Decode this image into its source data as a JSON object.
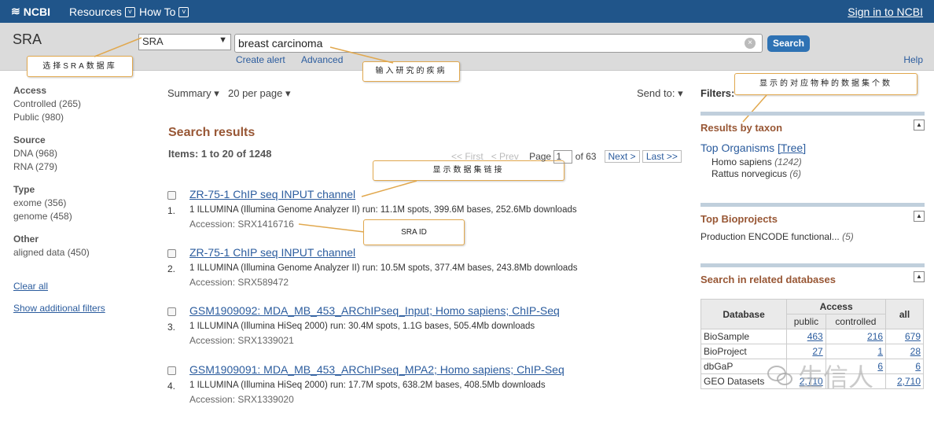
{
  "topbar": {
    "logo_mark": "≋",
    "logo_text": "NCBI",
    "resources": "Resources",
    "howto": "How To",
    "chev": "˅",
    "signin": "Sign in to NCBI"
  },
  "search": {
    "db_title": "SRA",
    "db_select": "SRA",
    "select_arrow": "▼",
    "query": "breast carcinoma",
    "clear": "×",
    "button": "Search",
    "create_alert": "Create alert",
    "advanced": "Advanced",
    "help": "Help"
  },
  "callouts": {
    "select_db": "选择SRA数据库",
    "enter_term": "输入研究的疾病",
    "organism_count": "显示的对应物种的数据集个数",
    "dataset_link": "显示数据集链接",
    "sra_id": "SRA ID"
  },
  "sidebar": {
    "groups": [
      {
        "head": "Access",
        "items": [
          "Controlled (265)",
          "Public (980)"
        ]
      },
      {
        "head": "Source",
        "items": [
          "DNA (968)",
          "RNA (279)"
        ]
      },
      {
        "head": "Type",
        "items": [
          "exome (356)",
          "genome (458)"
        ]
      },
      {
        "head": "Other",
        "items": [
          "aligned data (450)"
        ]
      }
    ],
    "clear_all": "Clear all",
    "show_filters": "Show additional filters"
  },
  "main": {
    "summary": "Summary",
    "per_page": "20 per page",
    "send_to": "Send to:",
    "dropdown_arrow": "▾",
    "results_title": "Search results",
    "items": "Items: 1 to 20 of 1248",
    "pager": {
      "first": "<< First",
      "prev": "< Prev",
      "page_label": "Page",
      "page_value": "1",
      "of": "of 63",
      "next": "Next >",
      "last": "Last >>"
    },
    "results": [
      {
        "num": "1.",
        "title": "ZR-75-1 ChIP seq INPUT channel",
        "desc": "1 ILLUMINA (Illumina Genome Analyzer II) run: 11.1M spots, 399.6M bases, 252.6Mb downloads",
        "acc": "Accession: SRX1416716"
      },
      {
        "num": "2.",
        "title": "ZR-75-1 ChIP seq INPUT channel",
        "desc": "1 ILLUMINA (Illumina Genome Analyzer II) run: 10.5M spots, 377.4M bases, 243.8Mb downloads",
        "acc": "Accession: SRX589472"
      },
      {
        "num": "3.",
        "title": "GSM1909092: MDA_MB_453_ARChIPseq_Input; Homo sapiens; ChIP-Seq",
        "desc": "1 ILLUMINA (Illumina HiSeq 2000) run: 30.4M spots, 1.1G bases, 505.4Mb downloads",
        "acc": "Accession: SRX1339021"
      },
      {
        "num": "4.",
        "title": "GSM1909091: MDA_MB_453_ARChIPseq_MPA2; Homo sapiens; ChIP-Seq",
        "desc": "1 ILLUMINA (Illumina HiSeq 2000) run: 17.7M spots, 638.2M bases, 408.5Mb downloads",
        "acc": "Accession: SRX1339020"
      }
    ]
  },
  "right": {
    "filters": "Filters:",
    "taxon_head": "Results by taxon",
    "top_organisms": "Top Organisms",
    "tree": "[Tree]",
    "organisms": [
      {
        "name": "Homo sapiens",
        "count": "(1242)"
      },
      {
        "name": "Rattus norvegicus",
        "count": "(6)"
      }
    ],
    "bioprojects_head": "Top Bioprojects",
    "bioproject_item": "Production ENCODE functional...",
    "bioproject_count": "(5)",
    "related_head": "Search in related databases",
    "collapse": "▲",
    "table": {
      "col_database": "Database",
      "col_access": "Access",
      "col_all": "all",
      "col_public": "public",
      "col_controlled": "controlled",
      "rows": [
        {
          "db": "BioSample",
          "public": "463",
          "controlled": "216",
          "all": "679"
        },
        {
          "db": "BioProject",
          "public": "27",
          "controlled": "1",
          "all": "28"
        },
        {
          "db": "dbGaP",
          "public": "",
          "controlled": "6",
          "all": "6"
        },
        {
          "db": "GEO Datasets",
          "public": "2,710",
          "controlled": "",
          "all": "2,710"
        }
      ]
    }
  },
  "watermark": "生信人"
}
